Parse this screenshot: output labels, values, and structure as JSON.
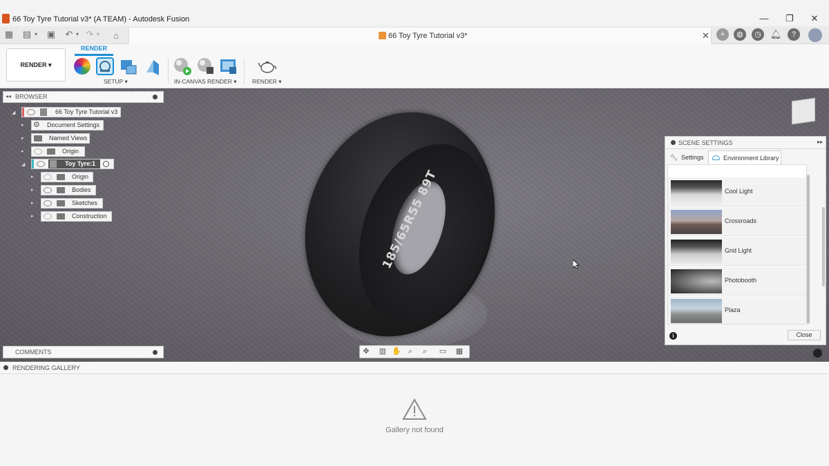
{
  "window": {
    "title": "66 Toy Tyre Tutorial v3* (A TEAM) - Autodesk Fusion",
    "minimize": "—",
    "maximize": "❐",
    "close": "✕"
  },
  "document_tab": {
    "title": "66 Toy Tyre Tutorial v3*",
    "close": "✕"
  },
  "ribbon": {
    "workspace_label": "RENDER ▾",
    "active_tab": "RENDER",
    "groups": {
      "setup": "SETUP ▾",
      "in_canvas": "IN-CANVAS RENDER ▾",
      "render": "RENDER ▾"
    }
  },
  "browser": {
    "title": "BROWSER",
    "root": "66 Toy Tyre Tutorial v3",
    "items": [
      {
        "label": "Document Settings"
      },
      {
        "label": "Named Views"
      },
      {
        "label": "Origin"
      }
    ],
    "component": "Toy Tyre:1",
    "children": [
      {
        "label": "Origin"
      },
      {
        "label": "Bodies"
      },
      {
        "label": "Sketches"
      },
      {
        "label": "Construction"
      }
    ]
  },
  "comments": {
    "title": "COMMENTS"
  },
  "tire": {
    "sidewall_text": "185/65R55 89T"
  },
  "scene_settings": {
    "title": "SCENE SETTINGS",
    "tabs": [
      {
        "label": "Settings"
      },
      {
        "label": "Environment Library"
      }
    ],
    "environments": [
      {
        "label": "Cool Light"
      },
      {
        "label": "Crossroads"
      },
      {
        "label": "Grid Light"
      },
      {
        "label": "Photobooth"
      },
      {
        "label": "Plaza"
      }
    ],
    "close_label": "Close",
    "info_label": "i"
  },
  "gallery": {
    "title": "RENDERING GALLERY",
    "message": "Gallery not found"
  },
  "colors": {
    "accent": "#1c8fd6",
    "viewport": "#6c6970"
  }
}
